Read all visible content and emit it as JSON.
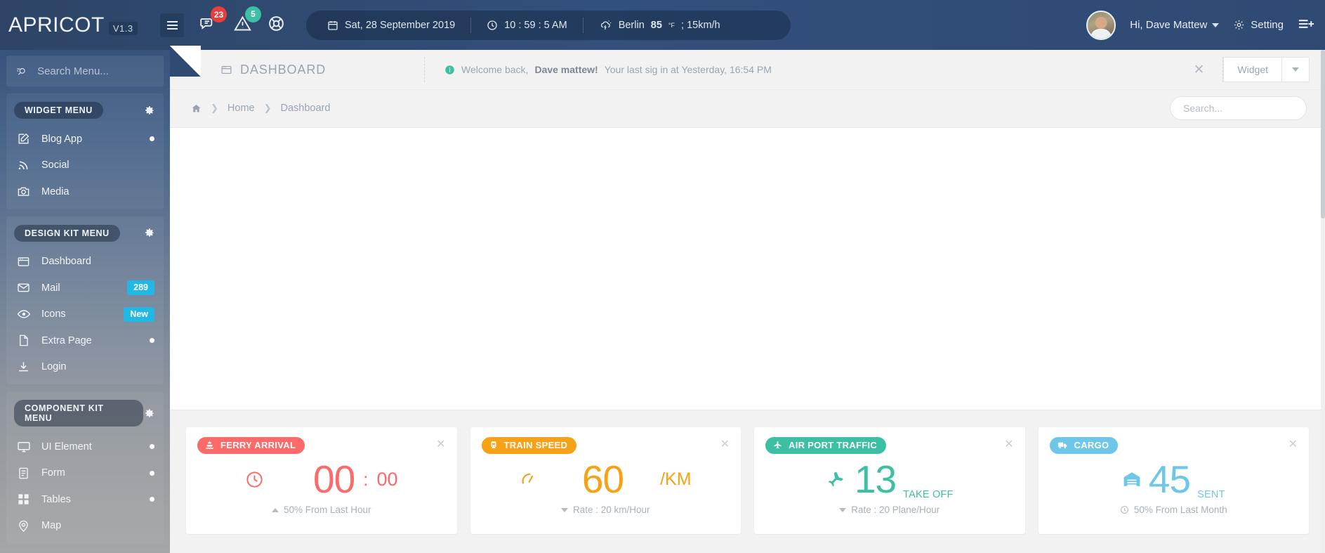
{
  "topbar": {
    "brand_name": "APRICOT",
    "brand_version": "V1.3",
    "menu_toggle": "hamburger-menu",
    "messages_badge": "23",
    "alerts_badge": "5",
    "support_icon": "lifebuoy-icon",
    "date": "Sat, 28 September 2019",
    "time": "10 : 59 : 5 AM",
    "weather_city": "Berlin",
    "weather_temp": "85",
    "weather_unit": "°F",
    "weather_wind": "; 15km/h",
    "greeting": "Hi, Dave Mattew",
    "setting_label": "Setting",
    "right_toggle": "list-plus-icon"
  },
  "sidebar": {
    "search_placeholder": "Search Menu...",
    "groups": [
      {
        "title": "WIDGET MENU",
        "items": [
          {
            "label": "Blog App",
            "icon": "edit-square-icon",
            "badge": "",
            "dot": true
          },
          {
            "label": "Social",
            "icon": "rss-icon",
            "badge": "",
            "dot": false
          },
          {
            "label": "Media",
            "icon": "camera-icon",
            "badge": "",
            "dot": false
          }
        ]
      },
      {
        "title": "DESIGN KIT MENU",
        "items": [
          {
            "label": "Dashboard",
            "icon": "window-icon",
            "badge": "",
            "dot": false
          },
          {
            "label": "Mail",
            "icon": "envelope-icon",
            "badge": "289",
            "dot": false
          },
          {
            "label": "Icons",
            "icon": "eye-icon",
            "badge": "New",
            "dot": false
          },
          {
            "label": "Extra Page",
            "icon": "file-icon",
            "badge": "",
            "dot": true
          },
          {
            "label": "Login",
            "icon": "download-icon",
            "badge": "",
            "dot": false
          }
        ]
      },
      {
        "title": "COMPONENT KIT MENU",
        "items": [
          {
            "label": "UI Element",
            "icon": "monitor-icon",
            "badge": "",
            "dot": true
          },
          {
            "label": "Form",
            "icon": "form-icon",
            "badge": "",
            "dot": true
          },
          {
            "label": "Tables",
            "icon": "grid-icon",
            "badge": "",
            "dot": true
          },
          {
            "label": "Map",
            "icon": "map-pin-icon",
            "badge": "",
            "dot": false
          }
        ]
      }
    ]
  },
  "page": {
    "title": "DASHBOARD",
    "alert_prefix": "Welcome back,",
    "alert_user": "Dave mattew!",
    "alert_rest": "Your last sig in at Yesterday, 16:54 PM",
    "widget_button": "Widget",
    "breadcrumb": [
      "Home",
      "Dashboard"
    ],
    "search_placeholder": "Search..."
  },
  "cards": [
    {
      "tag": "FERRY ARRIVAL",
      "tag_icon": "ferry-icon",
      "color": "#fc6a6a",
      "left_icon": "clock-icon",
      "value": "00",
      "separator": ":",
      "value2": "00",
      "unit": "",
      "footer_trend": "up",
      "footer": "50%  From Last Hour"
    },
    {
      "tag": "TRAIN SPEED",
      "tag_icon": "train-icon",
      "color": "#f7a116",
      "left_icon": "speedometer-icon",
      "value": "60",
      "separator": "",
      "value2": "",
      "unit": "/KM",
      "footer_trend": "down",
      "footer": "Rate : 20 km/Hour"
    },
    {
      "tag": "AIR PORT TRAFFIC",
      "tag_icon": "plane-up-icon",
      "color": "#3dbfa4",
      "left_icon": "plane-icon",
      "value": "13",
      "separator": "",
      "value2": "",
      "unit": "TAKE OFF",
      "footer_trend": "down",
      "footer": "Rate : 20 Plane/Hour"
    },
    {
      "tag": "CARGO",
      "tag_icon": "truck-icon",
      "color": "#6ec6e8",
      "left_icon": "warehouse-icon",
      "value": "45",
      "separator": "",
      "value2": "",
      "unit": "SENT",
      "footer_trend": "clock",
      "footer": "50% From Last Month"
    }
  ]
}
